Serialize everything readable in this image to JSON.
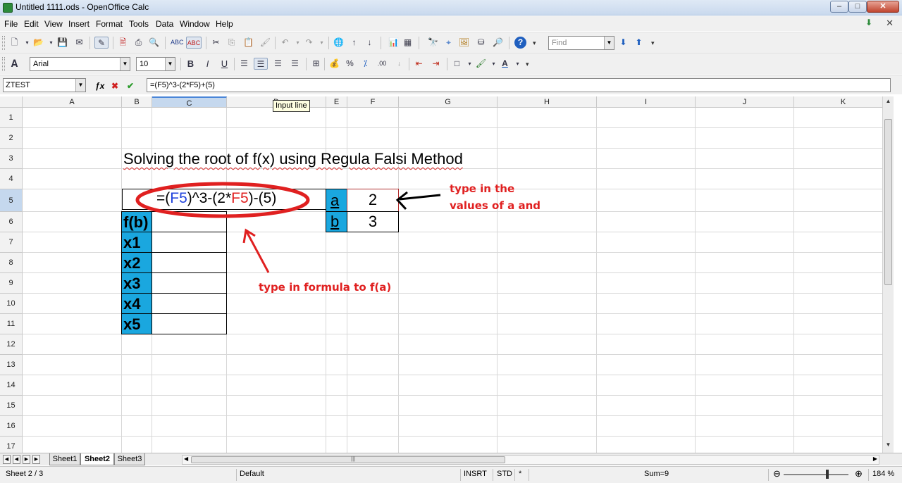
{
  "window": {
    "title": "Untitled 1111.ods - OpenOffice Calc"
  },
  "menu": [
    "File",
    "Edit",
    "View",
    "Insert",
    "Format",
    "Tools",
    "Data",
    "Window",
    "Help"
  ],
  "toolbar": {
    "find_placeholder": "Find",
    "font_name": "Arial",
    "font_size": "10",
    "bold_label": "B",
    "italic_label": "I",
    "underline_label": "U",
    "percent_label": "%",
    "decimal_label": ".00"
  },
  "formula_bar": {
    "name_box": "ZTEST",
    "formula": "=(F5)^3-(2*F5)+(5)",
    "tooltip": "Input line"
  },
  "sheet": {
    "columns": [
      "A",
      "B",
      "C",
      "D",
      "E",
      "F",
      "G",
      "H",
      "I",
      "J",
      "K"
    ],
    "rows": [
      "1",
      "2",
      "3",
      "4",
      "5",
      "6",
      "7",
      "8",
      "9",
      "10",
      "11",
      "12",
      "13",
      "14",
      "15",
      "16",
      "17"
    ],
    "selected_column": "C",
    "selected_row": "5",
    "heading": "Solving the root of f(x) using Regula Falsi Method",
    "formula_cell": {
      "prefix": "=(",
      "ref1": "F5",
      "mid": ")^3-(2*",
      "ref2": "F5",
      "suffix": ")-(5)"
    },
    "labels": [
      "f(b)",
      "x1",
      "x2",
      "x3",
      "x4",
      "x5"
    ],
    "inputs": [
      {
        "name": "a",
        "value": "2"
      },
      {
        "name": "b",
        "value": "3"
      }
    ]
  },
  "annotations": {
    "right_line1": "type in the",
    "right_line2": "values of a and",
    "bottom": "type in formula to f(a)",
    "color": "#e02020"
  },
  "tabs": [
    "Sheet1",
    "Sheet2",
    "Sheet3"
  ],
  "active_tab": "Sheet2",
  "status": {
    "sheet": "Sheet 2 / 3",
    "style": "Default",
    "mode": "INSRT",
    "selection": "STD",
    "modified": "*",
    "sum": "Sum=9",
    "zoom": "184 %"
  }
}
